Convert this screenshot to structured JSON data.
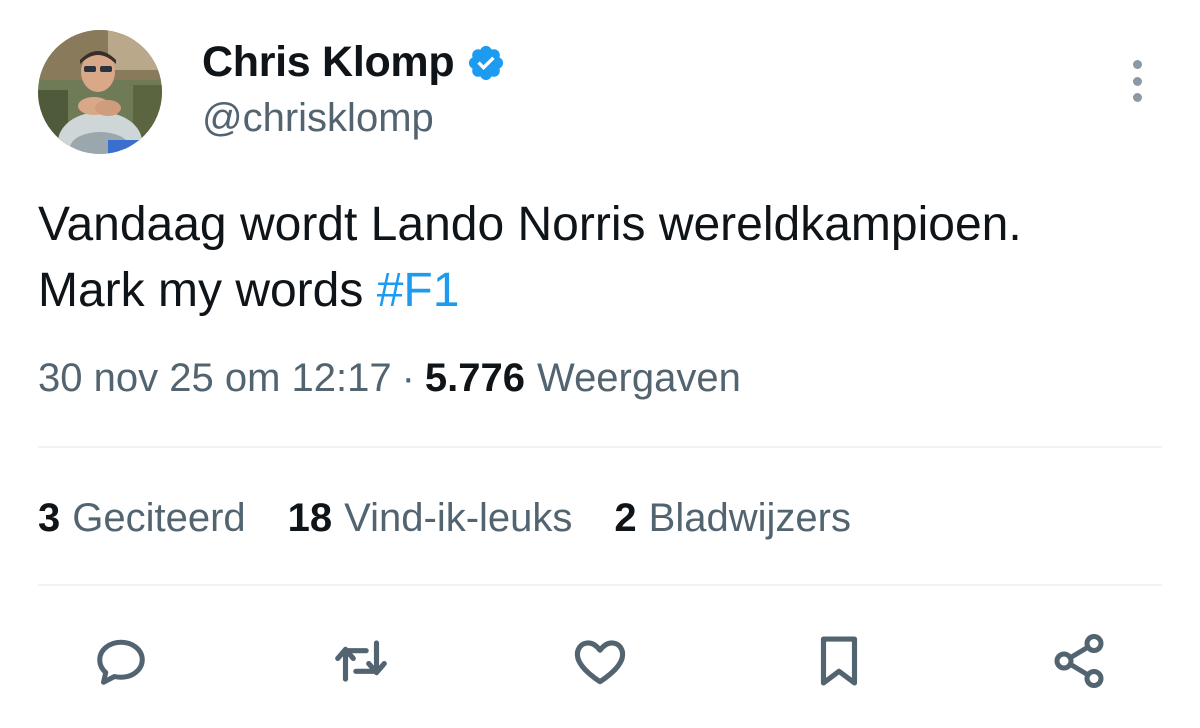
{
  "author": {
    "name": "Chris Klomp",
    "handle": "@chrisklomp",
    "verified": true,
    "verified_color": "#1d9bf0"
  },
  "tweet": {
    "text": "Vandaag wordt Lando Norris wereldkampioen. Mark my words ",
    "hashtag": "#F1",
    "hashtag_color": "#1d9bf0"
  },
  "meta": {
    "timestamp": "30 nov 25 om 12:17",
    "separator": "·",
    "views_count": "5.776",
    "views_label": "Weergaven"
  },
  "stats": [
    {
      "count": "3",
      "label": "Geciteerd"
    },
    {
      "count": "18",
      "label": "Vind-ik-leuks"
    },
    {
      "count": "2",
      "label": "Bladwijzers"
    }
  ],
  "actions": [
    {
      "icon": "reply-icon"
    },
    {
      "icon": "repost-icon"
    },
    {
      "icon": "like-icon"
    },
    {
      "icon": "bookmark-icon"
    },
    {
      "icon": "share-icon"
    }
  ]
}
